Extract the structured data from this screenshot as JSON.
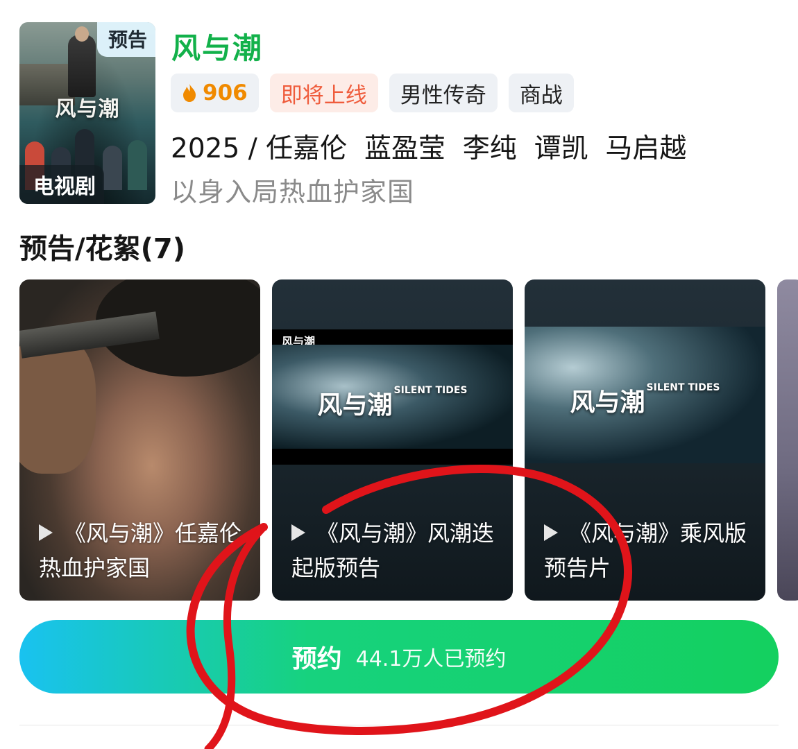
{
  "show": {
    "title": "风与潮",
    "poster_title": "风与潮",
    "poster_badge": "预告",
    "poster_type": "电视剧",
    "heat": "906",
    "tags": [
      "即将上线",
      "男性传奇",
      "商战"
    ],
    "meta_line": "2025 / 任嘉伦  蓝盈莹  李纯  谭凯  马启越",
    "slogan": "以身入局热血护家国"
  },
  "trailers": {
    "section_title": "预告/花絮(7)",
    "items": [
      {
        "caption": "《风与潮》任嘉伦热血护家国"
      },
      {
        "caption": "《风与潮》风潮迭起版预告",
        "film_title": "风与潮",
        "film_sub": "SILENT TIDES",
        "corner": "风与潮"
      },
      {
        "caption": "《风与潮》乘风版预告片",
        "film_title": "风与潮",
        "film_sub": "SILENT TIDES"
      }
    ]
  },
  "reserve": {
    "label": "预约",
    "count": "44.1万人已预约"
  },
  "colors": {
    "title_green": "#12b14a",
    "heat_orange": "#f08a00",
    "upcoming_red": "#ef5c3c",
    "annotation_red": "#e0141a"
  }
}
